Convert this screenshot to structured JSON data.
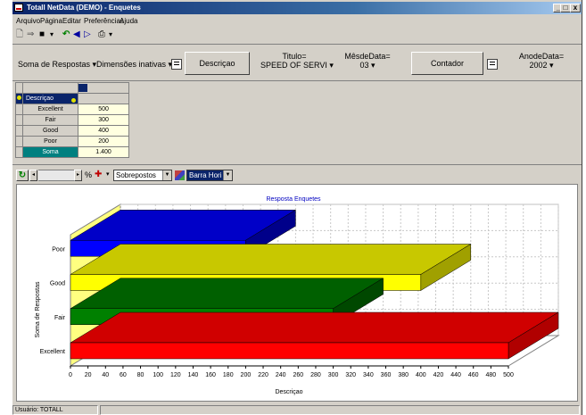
{
  "window": {
    "title": "Totall NetData (DEMO) - Enquetes",
    "minimize": "_",
    "maximize": "□",
    "close": "x"
  },
  "menu": [
    "Arquivo",
    "Página",
    "Editar",
    "Preferências",
    "Ajuda"
  ],
  "pivot": {
    "measure": "Soma de Respostas",
    "inactive": "Dimensões inativas",
    "row_dim": "Descriçao",
    "filters": [
      {
        "label": "Titulo=",
        "value": "SPEED OF SERVI"
      },
      {
        "label": "MêsdeData=",
        "value": "03"
      },
      {
        "label": "AnodeData=",
        "value": "2002"
      }
    ],
    "col_dim": "Contador"
  },
  "table": {
    "header": "Descriçao",
    "rows": [
      {
        "label": "Excellent",
        "value": "500"
      },
      {
        "label": "Fair",
        "value": "300"
      },
      {
        "label": "Good",
        "value": "400"
      },
      {
        "label": "Poor",
        "value": "200"
      }
    ],
    "total_label": "Soma",
    "total_value": "1.400"
  },
  "chart_toolbar": {
    "percent": "%",
    "mode": "Sobrepostos",
    "chart_type": "Barra Hori"
  },
  "chart_data": {
    "type": "bar",
    "orientation": "horizontal",
    "title": "Resposta Enquetes",
    "xlabel": "Descriçao",
    "ylabel": "Soma de Respostas",
    "categories": [
      "Excellent",
      "Fair",
      "Good",
      "Poor"
    ],
    "values": [
      500,
      300,
      400,
      200
    ],
    "colors": [
      "#ff0000",
      "#008000",
      "#ffff00",
      "#0000ff"
    ],
    "side_colors": [
      "#b00000",
      "#004800",
      "#a0a000",
      "#00008a"
    ],
    "top_colors": [
      "#d00000",
      "#006000",
      "#c8c800",
      "#0000c8"
    ],
    "xlim": [
      0,
      500
    ],
    "xticks": [
      0,
      20,
      40,
      60,
      80,
      100,
      120,
      140,
      160,
      180,
      200,
      220,
      240,
      260,
      280,
      300,
      320,
      340,
      360,
      380,
      400,
      420,
      440,
      460,
      480,
      500
    ],
    "grid": true
  },
  "status": "Usuário: TOTALL"
}
